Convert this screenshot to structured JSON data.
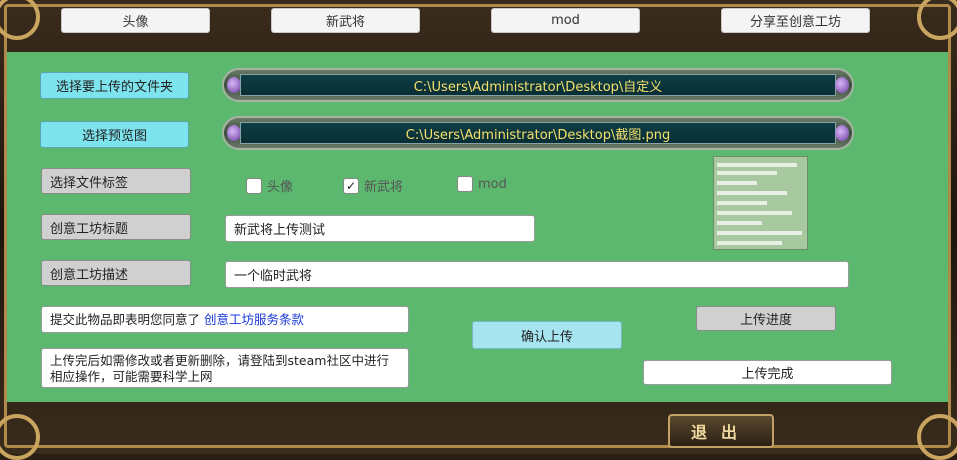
{
  "tabs": [
    {
      "label": "头像"
    },
    {
      "label": "新武将"
    },
    {
      "label": "mod"
    },
    {
      "label": "分享至创意工坊"
    }
  ],
  "form": {
    "select_folder_label": "选择要上传的文件夹",
    "folder_path": "C:\\Users\\Administrator\\Desktop\\自定义",
    "select_preview_label": "选择预览图",
    "preview_path": "C:\\Users\\Administrator\\Desktop\\截图.png",
    "select_tags_label": "选择文件标签",
    "tags": [
      {
        "label": "头像",
        "checked": false
      },
      {
        "label": "新武将",
        "checked": true
      },
      {
        "label": "mod",
        "checked": false
      }
    ],
    "title_label": "创意工坊标题",
    "title_value": "新武将上传测试",
    "desc_label": "创意工坊描述",
    "desc_value": "一个临时武将",
    "agreement_text": "提交此物品即表明您同意了",
    "agreement_link": "创意工坊服务条款",
    "hint_text": "上传完后如需修改或者更新删除，请登陆到steam社区中进行相应操作，可能需要科学上网",
    "confirm_upload_label": "确认上传",
    "progress_label": "上传进度",
    "status_text": "上传完成"
  },
  "exit_label": "退出"
}
